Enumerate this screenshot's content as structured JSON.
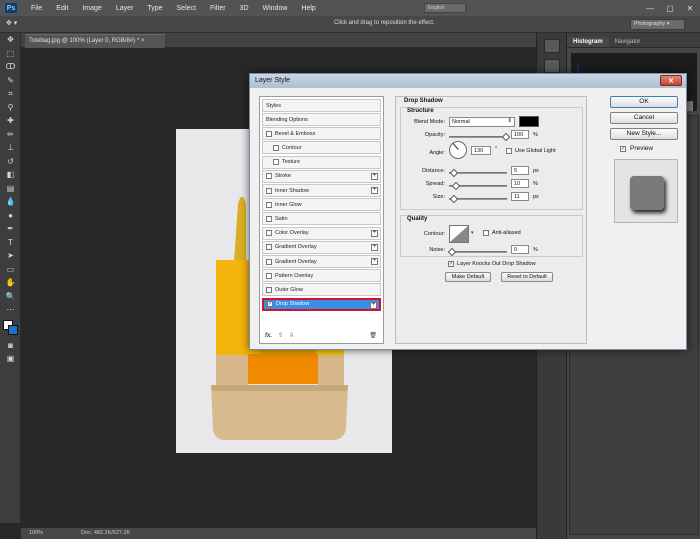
{
  "app": {
    "logo": "Ps"
  },
  "menu": [
    "File",
    "Edit",
    "Image",
    "Layer",
    "Type",
    "Select",
    "Filter",
    "3D",
    "Window",
    "Help"
  ],
  "menu_search": "English",
  "window_controls": [
    "—",
    "▢",
    "✕"
  ],
  "options": {
    "hint": "Click and drag to reposition the effect.",
    "workspace": "Photography ▾",
    "tool": "✥ ▾"
  },
  "document": {
    "tab_title": "Totebag.jpg @ 100% (Layer 0, RGB/8#) *  ×",
    "zoom": "100%",
    "doc_size": "Doc: 482.2K/627.2K"
  },
  "panel": {
    "tabs": [
      "Histogram",
      "Navigator"
    ]
  },
  "dialog": {
    "title": "Layer Style",
    "close": "✕",
    "styles_header": "Styles",
    "style_items": [
      {
        "label": "Blending Options",
        "checkbox": false,
        "plus": false,
        "sub": false,
        "checked": false
      },
      {
        "label": "Bevel & Emboss",
        "checkbox": true,
        "plus": false,
        "sub": false,
        "checked": false
      },
      {
        "label": "Contour",
        "checkbox": true,
        "plus": false,
        "sub": true,
        "checked": false
      },
      {
        "label": "Texture",
        "checkbox": true,
        "plus": false,
        "sub": true,
        "checked": false
      },
      {
        "label": "Stroke",
        "checkbox": true,
        "plus": true,
        "sub": false,
        "checked": false
      },
      {
        "label": "Inner Shadow",
        "checkbox": true,
        "plus": true,
        "sub": false,
        "checked": false
      },
      {
        "label": "Inner Glow",
        "checkbox": true,
        "plus": false,
        "sub": false,
        "checked": false
      },
      {
        "label": "Satin",
        "checkbox": true,
        "plus": false,
        "sub": false,
        "checked": false
      },
      {
        "label": "Color Overlay",
        "checkbox": true,
        "plus": true,
        "sub": false,
        "checked": false
      },
      {
        "label": "Gradient Overlay",
        "checkbox": true,
        "plus": true,
        "sub": false,
        "checked": false
      },
      {
        "label": "Gradient Overlay",
        "checkbox": true,
        "plus": true,
        "sub": false,
        "checked": false
      },
      {
        "label": "Pattern Overlay",
        "checkbox": true,
        "plus": false,
        "sub": false,
        "checked": false
      },
      {
        "label": "Outer Glow",
        "checkbox": true,
        "plus": false,
        "sub": false,
        "checked": false
      },
      {
        "label": "Drop Shadow",
        "checkbox": true,
        "plus": true,
        "sub": false,
        "checked": true,
        "selected": true
      }
    ],
    "footer_icons": [
      "fx.",
      "⇧",
      "⇩",
      "🗑"
    ],
    "drop_shadow": {
      "section_title": "Drop Shadow",
      "structure_title": "Structure",
      "blend_mode_label": "Blend Mode:",
      "blend_mode_value": "Normal",
      "shadow_color": "#000000",
      "opacity_label": "Opacity:",
      "opacity_value": "100",
      "percent": "%",
      "angle_label": "Angle:",
      "angle_value": "130",
      "degree": "°",
      "use_global_light": "Use Global Light",
      "distance_label": "Distance:",
      "distance_value": "5",
      "spread_label": "Spread:",
      "spread_value": "10",
      "size_label": "Size:",
      "size_value": "11",
      "px": "px",
      "quality_title": "Quality",
      "contour_label": "Contour:",
      "anti_aliased": "Anti-aliased",
      "noise_label": "Noise:",
      "noise_value": "0",
      "knocks_out": "Layer Knocks Out Drop Shadow",
      "make_default": "Make Default",
      "reset_default": "Reset to Default"
    },
    "buttons": {
      "ok": "OK",
      "cancel": "Cancel",
      "new_style": "New Style...",
      "preview": "Preview"
    }
  },
  "colors": {
    "selection": "#3a8ee6",
    "highlight_border": "#d0152b",
    "canvas_bg": "#282828",
    "panel_bg": "#474747"
  }
}
